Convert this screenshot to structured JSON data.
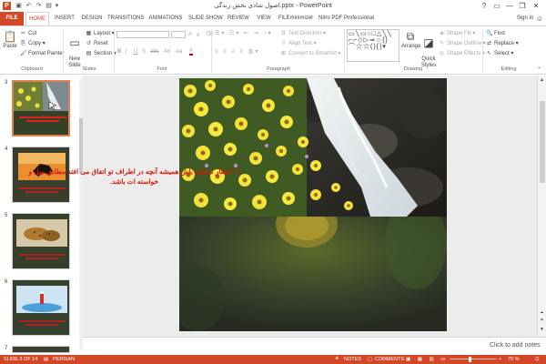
{
  "window": {
    "title": "اصول شادی بخش زندگی.pptx - PowerPoint",
    "controls": [
      "?",
      "▭",
      "—",
      "❐",
      "✕"
    ],
    "user": "Sign in"
  },
  "ribbon_tabs": [
    "FILE",
    "HOME",
    "INSERT",
    "DESIGN",
    "TRANSITIONS",
    "ANIMATIONS",
    "SLIDE SHOW",
    "REVIEW",
    "VIEW",
    "FILEminimizer",
    "Nitro PDF Professional"
  ],
  "clipboard": {
    "paste": "Paste",
    "cut": "Cut",
    "copy": "Copy",
    "format_painter": "Format Painter",
    "label": "Clipboard"
  },
  "slides_group": {
    "new_slide": "New\nSlide",
    "layout": "Layout",
    "reset": "Reset",
    "section": "Section",
    "label": "Slides"
  },
  "font_group": {
    "label": "Font",
    "font_size_up": "A",
    "font_size_down": "A",
    "styles": [
      "B",
      "I",
      "U",
      "S",
      "abc",
      "AV",
      "Aa",
      "A"
    ]
  },
  "paragraph_group": {
    "text_direction": "Text Direction",
    "align_text": "Align Text",
    "convert_smartart": "Convert to SmartArt",
    "label": "Paragraph"
  },
  "drawing_group": {
    "arrange": "Arrange",
    "quick_styles": "Quick\nStyles",
    "shape_fill": "Shape Fill",
    "shape_outline": "Shape Outline",
    "shape_effects": "Shape Effects",
    "label": "Drawing"
  },
  "editing_group": {
    "find": "Find",
    "replace": "Replace",
    "select": "Select",
    "label": "Editing"
  },
  "thumbnails": [
    {
      "number": "3",
      "selected": true
    },
    {
      "number": "4",
      "selected": false
    },
    {
      "number": "5",
      "selected": false
    },
    {
      "number": "6",
      "selected": false
    },
    {
      "number": "7",
      "selected": false
    }
  ],
  "slide": {
    "body_text": "۲. انتظار نداشته باش همیشه آنچه در اطراف تو اتفاق می افتد مطابق میل و خواسته ات باشد."
  },
  "notes_placeholder": "Click to add notes",
  "status": {
    "slide_info": "SLIDE 3 OF 14",
    "language": "PERSIAN",
    "notes": "NOTES",
    "comments": "COMMENTS",
    "zoom": "70 %"
  },
  "colors": {
    "accent": "#d24726",
    "slide_text": "#e4170c"
  }
}
